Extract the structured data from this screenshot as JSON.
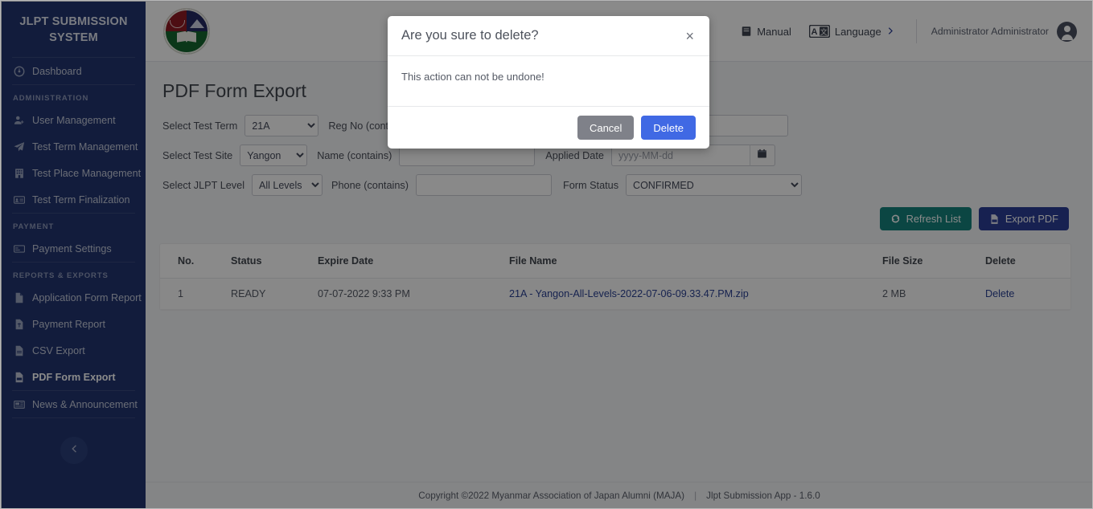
{
  "sidebar": {
    "brand": "JLPT SUBMISSION SYSTEM",
    "dashboard": {
      "label": "Dashboard",
      "icon": "dashboard-icon"
    },
    "groups": [
      {
        "heading": "ADMINISTRATION",
        "items": [
          {
            "label": "User Management",
            "icon": "user-plus-icon"
          },
          {
            "label": "Test Term Management",
            "icon": "paper-plane-icon"
          },
          {
            "label": "Test Place Management",
            "icon": "building-icon"
          },
          {
            "label": "Test Term Finalization",
            "icon": "id-card-icon"
          }
        ]
      },
      {
        "heading": "PAYMENT",
        "items": [
          {
            "label": "Payment Settings",
            "icon": "credit-card-icon"
          }
        ]
      },
      {
        "heading": "REPORTS & EXPORTS",
        "items": [
          {
            "label": "Application Form Report",
            "icon": "file-icon"
          },
          {
            "label": "Payment Report",
            "icon": "file-invoice-icon"
          },
          {
            "label": "CSV Export",
            "icon": "file-csv-icon"
          },
          {
            "label": "PDF Form Export",
            "icon": "file-pdf-icon",
            "active": true
          },
          {
            "label": "News & Announcement",
            "icon": "newspaper-icon"
          }
        ]
      }
    ],
    "collapse_icon": "chevron-left-icon",
    "active_color": "#ffffff",
    "background_color": "#22356f"
  },
  "topbar": {
    "logo_alt": "maja-logo",
    "manual_label": "Manual",
    "manual_icon": "book-icon",
    "language_label": "Language",
    "language_icon": "translate-icon",
    "language_chevron": "chevron-right-icon",
    "user_name": "Administrator Administrator",
    "avatar_icon": "user-avatar-icon"
  },
  "page": {
    "title": "PDF Form Export"
  },
  "filters": {
    "rows": [
      {
        "left": {
          "label": "Select Test Term",
          "type": "select",
          "value": "21A",
          "options": [
            "21A"
          ]
        },
        "mid": {
          "label": "Reg No (contains)",
          "type": "text",
          "value": "",
          "placeholder": ""
        },
        "right": {
          "label": "",
          "type": "text",
          "value": "",
          "placeholder": ""
        }
      },
      {
        "left": {
          "label": "Select Test Site",
          "type": "select",
          "value": "Yangon",
          "options": [
            "Yangon"
          ]
        },
        "mid": {
          "label": "Name (contains)",
          "type": "text",
          "value": "",
          "placeholder": ""
        },
        "right": {
          "label": "Applied Date",
          "type": "date",
          "value": "",
          "placeholder": "yyyy-MM-dd",
          "icon": "calendar-icon"
        }
      },
      {
        "left": {
          "label": "Select JLPT Level",
          "type": "select",
          "value": "All Levels",
          "options": [
            "All Levels"
          ]
        },
        "mid": {
          "label": "Phone (contains)",
          "type": "text",
          "value": "",
          "placeholder": ""
        },
        "right": {
          "label": "Form Status",
          "type": "select",
          "value": "CONFIRMED",
          "options": [
            "CONFIRMED"
          ]
        }
      }
    ],
    "refresh_button": {
      "label": "Refresh List",
      "icon": "refresh-icon",
      "color": "#16827d"
    },
    "export_button": {
      "label": "Export PDF",
      "icon": "file-pdf-icon",
      "color": "#2c3e96"
    }
  },
  "table": {
    "columns": [
      "No.",
      "Status",
      "Expire Date",
      "File Name",
      "File Size",
      "Delete"
    ],
    "rows": [
      {
        "no": "1",
        "status": "READY",
        "expire_date": "07-07-2022 9:33 PM",
        "file_name": "21A - Yangon-All-Levels-2022-07-06-09.33.47.PM.zip",
        "file_size": "2 MB",
        "delete_label": "Delete"
      }
    ]
  },
  "footer": {
    "copyright": "Copyright ©2022 Myanmar Association of Japan Alumni (MAJA)",
    "separator": "|",
    "app_version": "Jlpt Submission App - 1.6.0"
  },
  "modal": {
    "title": "Are you sure to delete?",
    "close_icon": "close-icon",
    "body": "This action can not be undone!",
    "cancel_label": "Cancel",
    "delete_label": "Delete",
    "delete_color": "#4069e4",
    "cancel_color": "#7f8189"
  }
}
